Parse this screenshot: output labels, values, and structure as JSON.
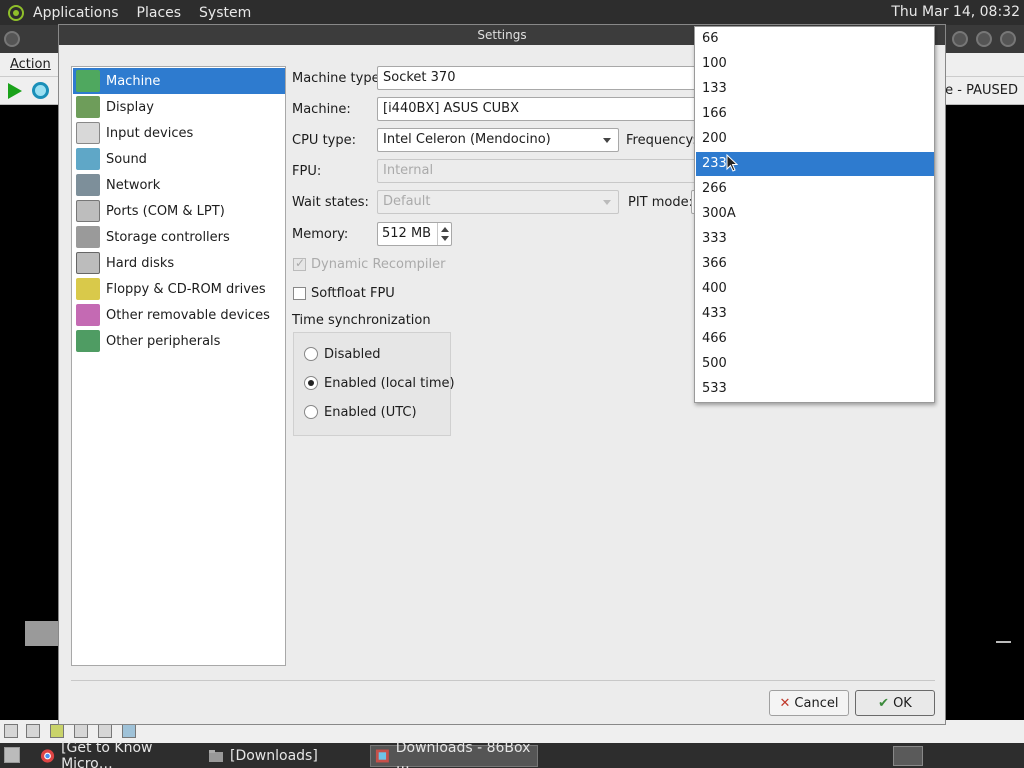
{
  "top_panel": {
    "menus": [
      "Applications",
      "Places",
      "System"
    ],
    "clock": "Thu Mar 14, 08:32"
  },
  "emulator_window": {
    "menu_action": "Action",
    "status_text": "use - PAUSED"
  },
  "taskbar": {
    "items": [
      {
        "label": "[Get to Know Micro…",
        "icon": "chrome-icon"
      },
      {
        "label": "[Downloads]",
        "icon": "folder-icon"
      },
      {
        "label": "Downloads - 86Box …",
        "icon": "86box-icon"
      }
    ]
  },
  "dialog": {
    "title": "Settings",
    "sidebar": [
      {
        "label": "Machine",
        "icon": "machine-icon"
      },
      {
        "label": "Display",
        "icon": "display-icon"
      },
      {
        "label": "Input devices",
        "icon": "input-devices-icon"
      },
      {
        "label": "Sound",
        "icon": "sound-icon"
      },
      {
        "label": "Network",
        "icon": "network-icon"
      },
      {
        "label": "Ports (COM & LPT)",
        "icon": "ports-icon"
      },
      {
        "label": "Storage controllers",
        "icon": "storage-icon"
      },
      {
        "label": "Hard disks",
        "icon": "hard-disk-icon"
      },
      {
        "label": "Floppy & CD-ROM drives",
        "icon": "floppy-cdrom-icon"
      },
      {
        "label": "Other removable devices",
        "icon": "removable-icon"
      },
      {
        "label": "Other peripherals",
        "icon": "peripherals-icon"
      }
    ],
    "selected_sidebar": "Machine",
    "machine": {
      "machine_type_label": "Machine type:",
      "machine_type_value": "Socket 370",
      "machine_label": "Machine:",
      "machine_value": "[i440BX] ASUS CUBX",
      "cpu_type_label": "CPU type:",
      "cpu_type_value": "Intel Celeron (Mendocino)",
      "frequency_label": "Frequency:",
      "fpu_label": "FPU:",
      "fpu_value": "Internal",
      "wait_states_label": "Wait states:",
      "wait_states_value": "Default",
      "pit_mode_label": "PIT mode:",
      "memory_label": "Memory:",
      "memory_value": "512 MB",
      "dynamic_recompiler_label": "Dynamic Recompiler",
      "dynamic_recompiler_checked": true,
      "softfloat_label": "Softfloat FPU",
      "softfloat_checked": false,
      "time_sync_label": "Time synchronization",
      "time_sync_options": [
        "Disabled",
        "Enabled (local time)",
        "Enabled (UTC)"
      ],
      "time_sync_selected": "Enabled (local time)"
    },
    "buttons": {
      "cancel": "Cancel",
      "cancel_mnemonic": "C",
      "ok": "OK",
      "ok_mnemonic": "O"
    }
  },
  "frequency_dropdown": {
    "options": [
      "66",
      "100",
      "133",
      "166",
      "200",
      "233",
      "266",
      "300A",
      "333",
      "366",
      "400",
      "433",
      "466",
      "500",
      "533"
    ],
    "selected": "233"
  },
  "colors": {
    "selection": "#2e7bcf",
    "panel": "#2d2d2d"
  }
}
